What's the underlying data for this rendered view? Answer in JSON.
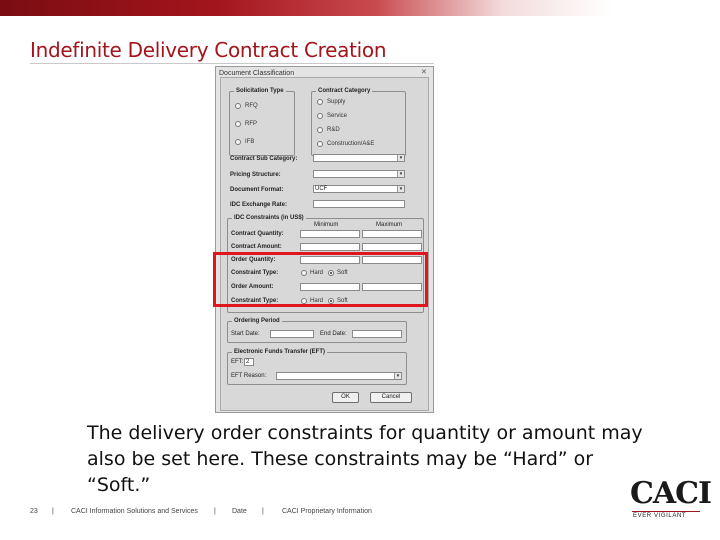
{
  "slide": {
    "title": "Indefinite Delivery Contract Creation",
    "caption": "The delivery order constraints for quantity or amount may also be set here.  These constraints may be “Hard” or “Soft.”"
  },
  "dialog": {
    "title": "Document Classification",
    "solicitation_type": {
      "label": "Solicitation Type",
      "options": [
        "RFQ",
        "RFP",
        "IFB"
      ]
    },
    "contract_category": {
      "label": "Contract Category",
      "options": [
        "Supply",
        "Service",
        "R&D",
        "Construction/A&E"
      ]
    },
    "contract_sub_category": {
      "label": "Contract Sub Category:",
      "value": ""
    },
    "pricing_structure": {
      "label": "Pricing Structure:",
      "value": ""
    },
    "document_format": {
      "label": "Document Format:",
      "value": "UCF"
    },
    "idc_exchange_rate": {
      "label": "IDC Exchange Rate:",
      "value": ""
    },
    "idc_constraints": {
      "label": "IDC Constraints (in US$)",
      "minimum_header": "Minimum",
      "maximum_header": "Maximum",
      "contract_quantity_label": "Contract Quantity:",
      "contract_amount_label": "Contract Amount:",
      "order_quantity_label": "Order Quantity:",
      "constraint_type_label_1": "Constraint Type:",
      "order_amount_label": "Order Amount:",
      "constraint_type_label_2": "Constraint Type:",
      "hard_label": "Hard",
      "soft_label": "Soft",
      "selected": "Soft"
    },
    "ordering_period": {
      "label": "Ordering Period",
      "start_date_label": "Start Date:",
      "end_date_label": "End Date:"
    },
    "eft": {
      "label": "Electronic Funds Transfer (EFT)",
      "eft_label": "EFT:",
      "eft_value": "2",
      "eft_reason_label": "EFT Reason:"
    },
    "ok_label": "OK",
    "cancel_label": "Cancel"
  },
  "footer": {
    "page_number": "23",
    "sep1": "|",
    "company": "CACI Information Solutions and Services",
    "sep2": "|",
    "date": "Date",
    "sep3": "|",
    "proprietary": "CACI Proprietary Information"
  },
  "logo": {
    "name": "CACI",
    "tagline": "EVER VIGILANT"
  },
  "colors": {
    "accent": "#a3151c",
    "highlight": "#e0161e"
  }
}
